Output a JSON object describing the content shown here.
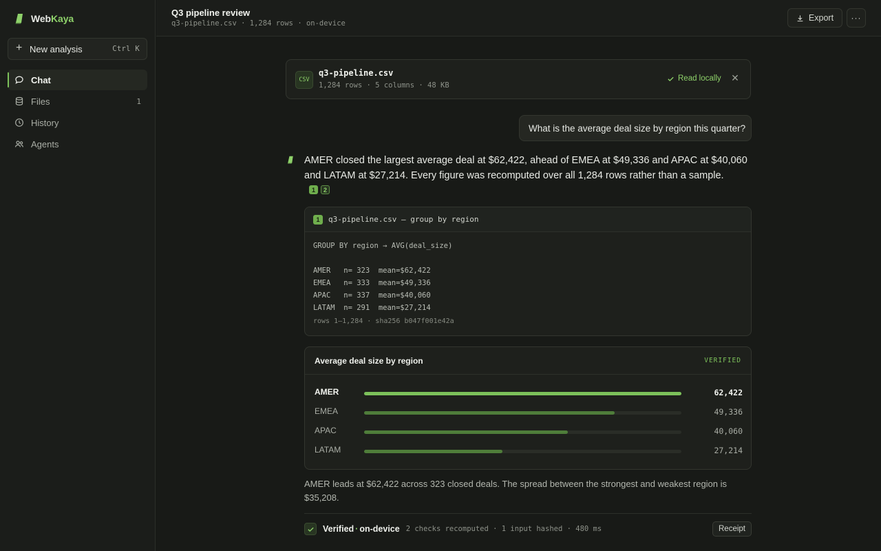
{
  "brand": {
    "name_part1": "Web",
    "name_part2": "Kaya"
  },
  "sidebar": {
    "new_analysis": {
      "label": "New analysis",
      "shortcut": "Ctrl K"
    },
    "items": [
      {
        "label": "Chat",
        "icon": "chat-bubble-icon",
        "active": true,
        "count": ""
      },
      {
        "label": "Files",
        "icon": "database-icon",
        "active": false,
        "count": "1"
      },
      {
        "label": "History",
        "icon": "clock-icon",
        "active": false,
        "count": ""
      },
      {
        "label": "Agents",
        "icon": "users-icon",
        "active": false,
        "count": ""
      }
    ]
  },
  "header": {
    "title": "Q3 pipeline review",
    "subtitle": "q3-pipeline.csv · 1,284 rows · on-device",
    "export_label": "Export",
    "more_label": "···"
  },
  "file_card": {
    "badge": "CSV",
    "name": "q3-pipeline.csv",
    "meta": "1,284 rows · 5 columns · 48 KB",
    "status": "Read locally",
    "close": "✕"
  },
  "user_message": "What is the average deal size by region this quarter?",
  "answer": {
    "text": "AMER closed the largest average deal at $62,422, ahead of EMEA at $49,336 and APAC at $40,060 and LATAM at $27,214. Every figure was recomputed over all 1,284 rows rather than a sample.",
    "citations": [
      "1",
      "2"
    ]
  },
  "code_block": {
    "number": "1",
    "title": "q3-pipeline.csv — group by region",
    "body": "GROUP BY region → AVG(deal_size)\n\nAMER   n= 323  mean=$62,422\nEMEA   n= 333  mean=$49,336\nAPAC   n= 337  mean=$40,060\nLATAM  n= 291  mean=$27,214",
    "footer": "rows 1–1,284 · sha256 b047f001e42a"
  },
  "chart_data": {
    "type": "bar",
    "title": "Average deal size by region",
    "status": "VERIFIED",
    "categories": [
      "AMER",
      "EMEA",
      "APAC",
      "LATAM"
    ],
    "values": [
      62422,
      49336,
      40060,
      27214
    ],
    "value_labels": [
      "62,422",
      "49,336",
      "40,060",
      "27,214"
    ],
    "xlim": [
      0,
      62422
    ],
    "orientation": "horizontal",
    "colors": [
      "#7cc05a",
      "#4f7d3a",
      "#4f7d3a",
      "#4f7d3a"
    ]
  },
  "summary": "AMER leads at $62,422 across 323 closed deals. The spread between the strongest and weakest region is $35,208.",
  "verification": {
    "title_part1": "Verified",
    "separator": "·",
    "title_part2": "on-device",
    "meta": "2 checks recomputed · 1 input hashed · 480 ms",
    "receipt_label": "Receipt"
  },
  "colors": {
    "accent": "#8ed16a",
    "background": "#181a17",
    "border": "#33362f"
  }
}
